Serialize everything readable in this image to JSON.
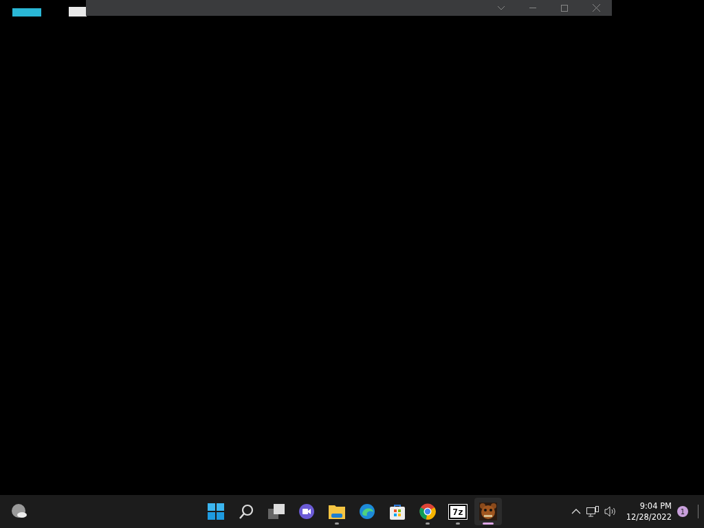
{
  "taskbar": {
    "apps": [
      {
        "kind": "start",
        "running": false,
        "active": false
      },
      {
        "kind": "search",
        "running": false,
        "active": false
      },
      {
        "kind": "taskview",
        "running": false,
        "active": false
      },
      {
        "kind": "chat",
        "running": false,
        "active": false
      },
      {
        "kind": "explorer",
        "running": true,
        "active": false
      },
      {
        "kind": "edge",
        "running": false,
        "active": false
      },
      {
        "kind": "store",
        "running": false,
        "active": false
      },
      {
        "kind": "chrome",
        "running": true,
        "active": false
      },
      {
        "kind": "sevenzip",
        "label": "7z",
        "running": true,
        "active": false
      },
      {
        "kind": "game",
        "running": true,
        "active": true
      }
    ],
    "clock": {
      "time": "9:04 PM",
      "date": "12/28/2022"
    },
    "notification_count": "1"
  }
}
